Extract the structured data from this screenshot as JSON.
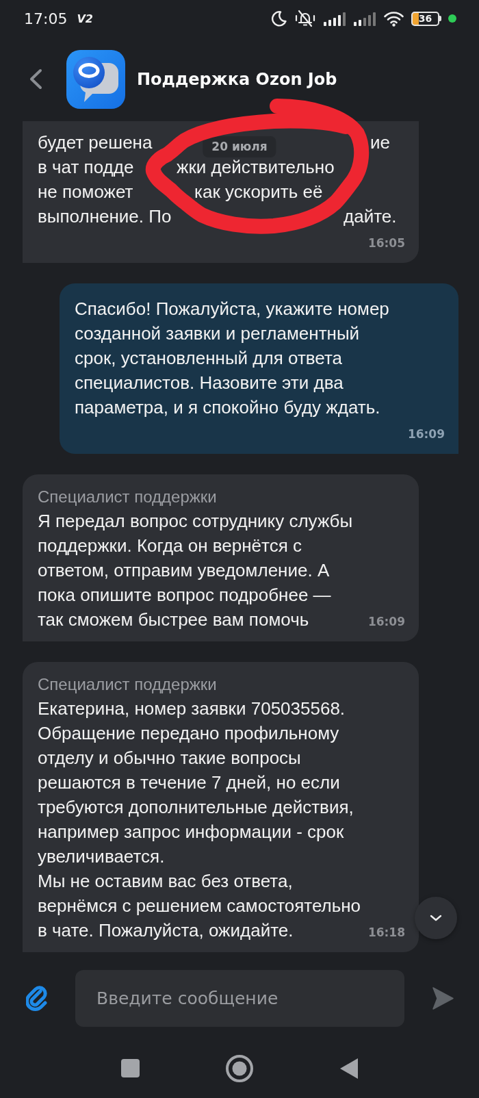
{
  "status_bar": {
    "time": "17:05",
    "network_label": "V2",
    "battery_text": "36"
  },
  "header": {
    "title": "Поддержка Ozon Job"
  },
  "date_chip": "20 июля",
  "messages": [
    {
      "kind": "obscured",
      "outgoing": false,
      "lines": [
        [
          "будет решена",
          "ие"
        ],
        [
          "в чат подде",
          "жки действительно"
        ],
        [
          "не поможет",
          "как ускорить её"
        ],
        [
          "выполнение. По",
          "дайте."
        ]
      ],
      "time": "16:05"
    },
    {
      "kind": "text",
      "outgoing": true,
      "text": "Спасибо! Пожалуйста, укажите номер\nсозданной заявки и регламентный\nсрок, установленный для ответа\nспециалистов. Назовите эти два\nпараметра, и я спокойно буду ждать.",
      "time": "16:09"
    },
    {
      "kind": "text",
      "outgoing": false,
      "sender": "Специалист поддержки",
      "text": "Я передал вопрос сотруднику службы\nподдержки. Когда он вернётся с\nответом, отправим уведомление. А\nпока опишите вопрос подробнее —\nтак сможем быстрее вам помочь",
      "time": "16:09"
    },
    {
      "kind": "text",
      "outgoing": false,
      "sender": "Специалист поддержки",
      "text": "Екатерина, номер заявки 705035568.\nОбращение передано профильному\nотделу и обычно такие вопросы\nрешаются в течение 7 дней, но если\nтребуются дополнительные действия,\nнапример запрос информации - срок\nувеличивается.\nМы не оставим вас без ответа,\nвернёмся с решением самостоятельно\nв чате. Пожалуйста, ожидайте.",
      "time": "16:18"
    }
  ],
  "composer": {
    "placeholder": "Введите сообщение"
  }
}
